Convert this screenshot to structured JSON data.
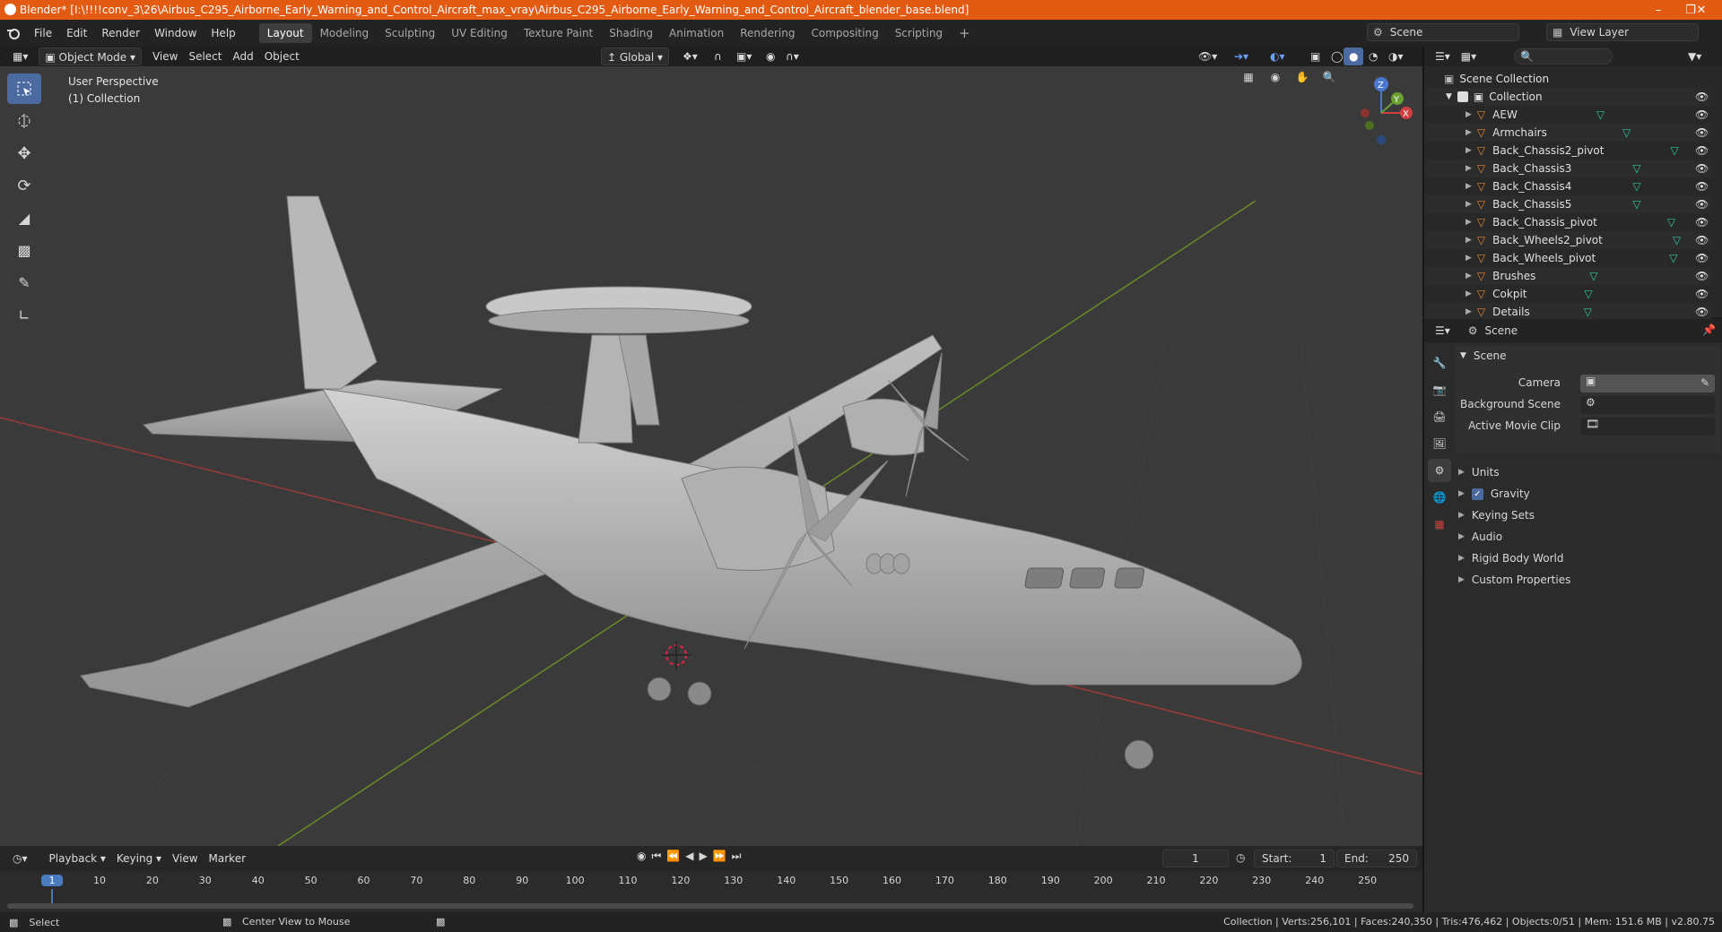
{
  "titlebar": {
    "title": "Blender* [I:\\!!!!conv_3\\26\\Airbus_C295_Airborne_Early_Warning_and_Control_Aircraft_max_vray\\Airbus_C295_Airborne_Early_Warning_and_Control_Aircraft_blender_base.blend]"
  },
  "menu": {
    "items": [
      "File",
      "Edit",
      "Render",
      "Window",
      "Help"
    ],
    "workspaces": [
      "Layout",
      "Modeling",
      "Sculpting",
      "UV Editing",
      "Texture Paint",
      "Shading",
      "Animation",
      "Rendering",
      "Compositing",
      "Scripting"
    ],
    "scene_label": "Scene",
    "view_layer_label": "View Layer"
  },
  "viewport_header": {
    "mode": "Object Mode",
    "menus": [
      "View",
      "Select",
      "Add",
      "Object"
    ],
    "orientation": "Global"
  },
  "viewport": {
    "overlay_line1": "User Perspective",
    "overlay_line2": "(1) Collection",
    "gizmo": {
      "x": "X",
      "y": "Y",
      "z": "Z"
    }
  },
  "outliner": {
    "root": "Scene Collection",
    "collection": "Collection",
    "items": [
      "AEW",
      "Armchairs",
      "Back_Chassis2_pivot",
      "Back_Chassis3",
      "Back_Chassis4",
      "Back_Chassis5",
      "Back_Chassis_pivot",
      "Back_Wheels2_pivot",
      "Back_Wheels_pivot",
      "Brushes",
      "Cokpit",
      "Details"
    ]
  },
  "properties": {
    "header": "Scene",
    "panel_title": "Scene",
    "camera_label": "Camera",
    "background_scene_label": "Background Scene",
    "active_movie_clip_label": "Active Movie Clip",
    "sections": [
      "Units",
      "Gravity",
      "Keying Sets",
      "Audio",
      "Rigid Body World",
      "Custom Properties"
    ],
    "gravity_checked": true
  },
  "timeline": {
    "menus": [
      "Playback",
      "Keying",
      "View",
      "Marker"
    ],
    "current_frame": "1",
    "start_label": "Start:",
    "start_value": "1",
    "end_label": "End:",
    "end_value": "250",
    "ruler_labels": [
      "1",
      "10",
      "20",
      "30",
      "40",
      "50",
      "60",
      "70",
      "80",
      "90",
      "100",
      "110",
      "120",
      "130",
      "140",
      "150",
      "160",
      "170",
      "180",
      "190",
      "200",
      "210",
      "220",
      "230",
      "240",
      "250"
    ]
  },
  "statusbar": {
    "left_action": "Select",
    "middle_action": "Center View to Mouse",
    "stats": "Collection | Verts:256,101 | Faces:240,350 | Tris:476,462 | Objects:0/51 | Mem: 151.6 MB | v2.80.75"
  },
  "colors": {
    "title_bar": "#e35b12",
    "accent_blue": "#4a6aa0",
    "frame_marker": "#4a7ac0",
    "mesh_icon": "#32c8a0",
    "object_icon": "#e08a3c"
  }
}
